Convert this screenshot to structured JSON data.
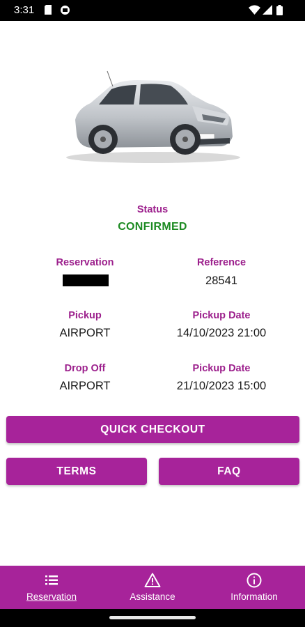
{
  "status_bar": {
    "time": "3:31",
    "icons": [
      "sim-card-icon",
      "media-icon",
      "wifi-icon",
      "signal-icon",
      "battery-icon"
    ]
  },
  "vehicle": {
    "image": "car-photo"
  },
  "reservation": {
    "status_label": "Status",
    "status_value": "CONFIRMED",
    "status_color": "#1c8a22",
    "reservation_label": "Reservation",
    "reference_label": "Reference",
    "reference_value": "28541",
    "pickup_label": "Pickup",
    "pickup_value": "AIRPORT",
    "pickup_date_label": "Pickup Date",
    "pickup_date_value": "14/10/2023 21:00",
    "dropoff_label": "Drop Off",
    "dropoff_value": "AIRPORT",
    "dropoff_date_label": "Pickup Date",
    "dropoff_date_value": "21/10/2023 15:00"
  },
  "actions": {
    "quick_checkout": "QUICK CHECKOUT",
    "terms": "TERMS",
    "faq": "FAQ"
  },
  "bottom_nav": {
    "items": [
      {
        "label": "Reservation",
        "icon": "list-icon",
        "active": true
      },
      {
        "label": "Assistance",
        "icon": "warning-icon",
        "active": false
      },
      {
        "label": "Information",
        "icon": "info-icon",
        "active": false
      }
    ]
  },
  "colors": {
    "accent": "#a7239a",
    "label": "#9c1f8c",
    "confirmed": "#1c8a22"
  }
}
